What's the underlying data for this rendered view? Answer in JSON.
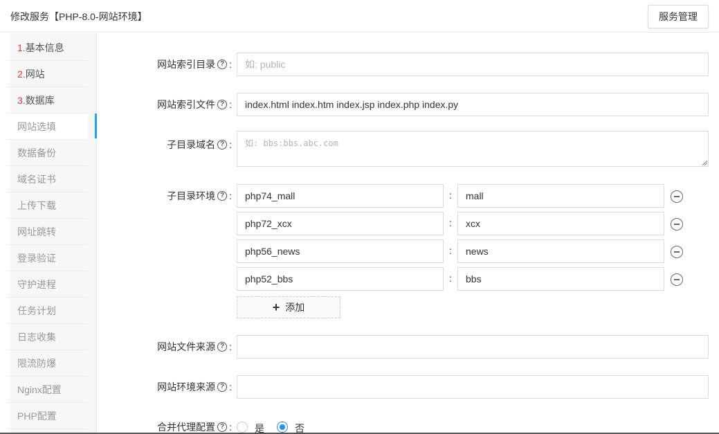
{
  "header": {
    "title": "修改服务【PHP-8.0-网站环境】",
    "manage_button": "服务管理"
  },
  "sidebar": {
    "items": [
      {
        "num": "1.",
        "label": "基本信息"
      },
      {
        "num": "2.",
        "label": "网站"
      },
      {
        "num": "3.",
        "label": "数据库"
      },
      {
        "num": "",
        "label": "网站选填"
      },
      {
        "num": "",
        "label": "数据备份"
      },
      {
        "num": "",
        "label": "域名证书"
      },
      {
        "num": "",
        "label": "上传下载"
      },
      {
        "num": "",
        "label": "网址跳转"
      },
      {
        "num": "",
        "label": "登录验证"
      },
      {
        "num": "",
        "label": "守护进程"
      },
      {
        "num": "",
        "label": "任务计划"
      },
      {
        "num": "",
        "label": "日志收集"
      },
      {
        "num": "",
        "label": "限流防爆"
      },
      {
        "num": "",
        "label": "Nginx配置"
      },
      {
        "num": "",
        "label": "PHP配置"
      }
    ],
    "active_index": 3
  },
  "form": {
    "index_dir": {
      "label": "网站索引目录",
      "value": "",
      "placeholder": "如: public"
    },
    "index_file": {
      "label": "网站索引文件",
      "value": "index.html index.htm index.jsp index.php index.py"
    },
    "subdomain": {
      "label": "子目录域名",
      "placeholder": "如: bbs:bbs.abc.com"
    },
    "subenv": {
      "label": "子目录环境",
      "separator": ":",
      "rows": [
        {
          "key": "php74_mall",
          "value": "mall"
        },
        {
          "key": "php72_xcx",
          "value": "xcx"
        },
        {
          "key": "php56_news",
          "value": "news"
        },
        {
          "key": "php52_bbs",
          "value": "bbs"
        }
      ],
      "add_label": "添加"
    },
    "file_source": {
      "label": "网站文件来源",
      "value": ""
    },
    "env_source": {
      "label": "网站环境来源",
      "value": ""
    },
    "merge_proxy": {
      "label": "合并代理配置",
      "options": [
        "是",
        "否"
      ],
      "selected": "否"
    }
  },
  "icons": {
    "help": "question-circle-icon",
    "remove": "minus-circle-icon",
    "add": "plus-icon"
  },
  "colors": {
    "accent": "#1e90ff",
    "step_number": "#e4393c"
  }
}
